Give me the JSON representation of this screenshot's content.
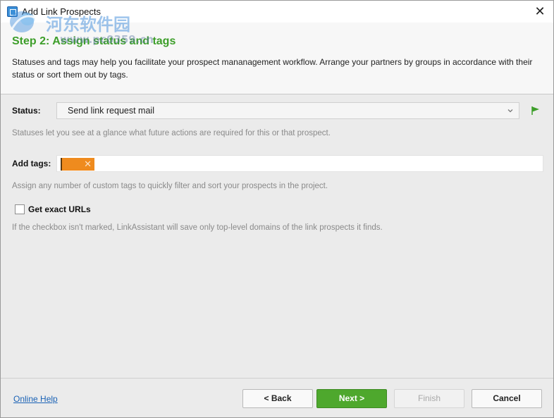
{
  "window": {
    "title": "Add Link Prospects",
    "close_glyph": "✕"
  },
  "watermark": {
    "text": "河东软件园",
    "sub": "www.pc0359.cn"
  },
  "header": {
    "step_title": "Step 2: Assign status and tags",
    "description": "Statuses and tags may help you facilitate your prospect mananagement workflow. Arrange your partners by groups in accordance with their status or sort them out by tags."
  },
  "status": {
    "label": "Status:",
    "value": "Send link request mail",
    "hint": "Statuses let you see at a glance what future actions are required for this or that prospect.",
    "flag_color": "#3d9e2a"
  },
  "tags": {
    "label": "Add tags:",
    "chip_color": "#ef8b1e",
    "chip_remove": "✕",
    "hint": "Assign any number of custom tags to quickly filter and sort your prospects in the project."
  },
  "exact_urls": {
    "label": "Get exact URLs",
    "checked": false,
    "hint": "If the checkbox isn't marked, LinkAssistant will save only top-level domains of the link prospects it finds."
  },
  "footer": {
    "help_link": "Online Help",
    "back_label": "< Back",
    "next_label": "Next >",
    "finish_label": "Finish",
    "cancel_label": "Cancel"
  },
  "colors": {
    "accent_green": "#4ea82d",
    "link_blue": "#1a62b5"
  }
}
